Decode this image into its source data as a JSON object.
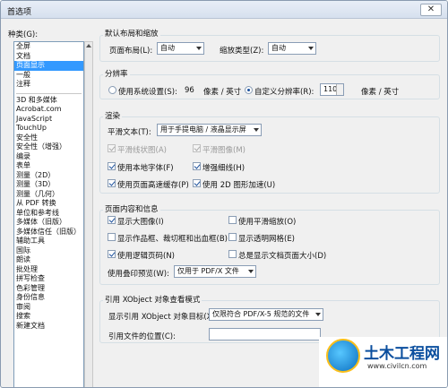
{
  "window": {
    "title": "首选项",
    "close_glyph": "✕"
  },
  "categories": {
    "label": "种类(G):",
    "top_items": [
      "全屏",
      "文档",
      "页面显示",
      "一般",
      "注释"
    ],
    "selected": "页面显示",
    "items": [
      "3D 和多媒体",
      "Acrobat.com",
      "JavaScript",
      "TouchUp",
      "安全性",
      "安全性（增强）",
      "编录",
      "表单",
      "测量（2D）",
      "测量（3D）",
      "测量（几何）",
      "从 PDF 转换",
      "单位和参考线",
      "多媒体（旧版）",
      "多媒体信任（旧版）",
      "辅助工具",
      "国际",
      "朗读",
      "批处理",
      "拼写检查",
      "色彩管理",
      "身份信息",
      "审阅",
      "搜索",
      "新建文档"
    ]
  },
  "layout": {
    "title": "默认布局和缩放",
    "page_layout_label": "页面布局(L):",
    "page_layout_value": "自动",
    "zoom_label": "缩放类型(Z):",
    "zoom_value": "自动"
  },
  "resolution": {
    "title": "分辨率",
    "system_label": "使用系统设置(S):",
    "system_value": "96",
    "system_unit": "像素 / 英寸",
    "custom_label": "自定义分辨率(R):",
    "custom_value": "110",
    "custom_unit": "像素 / 英寸",
    "selected": "custom"
  },
  "rendering": {
    "title": "渲染",
    "smooth_text_label": "平滑文本(T):",
    "smooth_text_value": "用于手提电脑 / 液晶显示屏",
    "smooth_lineart": "平滑线状图(A)",
    "smooth_images": "平滑图像(M)",
    "use_local_fonts": "使用本地字体(F)",
    "enhance_thin_lines": "增强细线(H)",
    "use_page_cache": "使用页面高速缓存(P)",
    "use_2d_gpu": "使用 2D 图形加速(U)"
  },
  "page_content": {
    "title": "页面内容和信息",
    "show_large_images": "显示大图像(I)",
    "use_smooth_zoom": "使用平滑缩放(O)",
    "show_art_trim": "显示作品框、裁切框和出血框(B)",
    "show_transparency_grid": "显示透明网格(E)",
    "use_logical_page_numbers": "使用逻辑页码(N)",
    "always_show_doc_page_size": "总是显示文档页面大小(D)",
    "overprint_label": "使用叠印预览(W):",
    "overprint_value": "仅用于 PDF/X 文件"
  },
  "xobject": {
    "title": "引用 XObject 对象查看模式",
    "show_label": "显示引用 XObject 对象目标(X):",
    "show_value": "仅限符合 PDF/X-5 规范的文件",
    "location_label": "引用文件的位置(C):"
  },
  "watermark": {
    "name": "土木工程网",
    "url": "www.civilcn.com"
  }
}
